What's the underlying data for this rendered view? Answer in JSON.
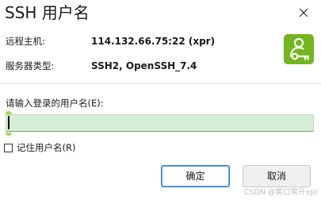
{
  "window": {
    "title": "SSH 用户名"
  },
  "info": {
    "host_label": "远程主机:",
    "host_value": "114.132.66.75:22 (xpr)",
    "server_type_label": "服务器类型:",
    "server_type_value": "SSH2, OpenSSH_7.4"
  },
  "form": {
    "prompt": "请输入登录的用户名(E):",
    "username_value": "",
    "remember_label": "记住用户名(R)",
    "remember_checked": false
  },
  "buttons": {
    "ok_label": "确定",
    "cancel_label": "取消"
  },
  "icons": {
    "close": "close-icon",
    "key": "user-key-icon"
  },
  "colors": {
    "key_icon_bg": "#73b51e",
    "input_bg": "#d6edd8",
    "ok_border": "#2f7fd0"
  },
  "watermark": "CSDN @笑口常开xpr"
}
